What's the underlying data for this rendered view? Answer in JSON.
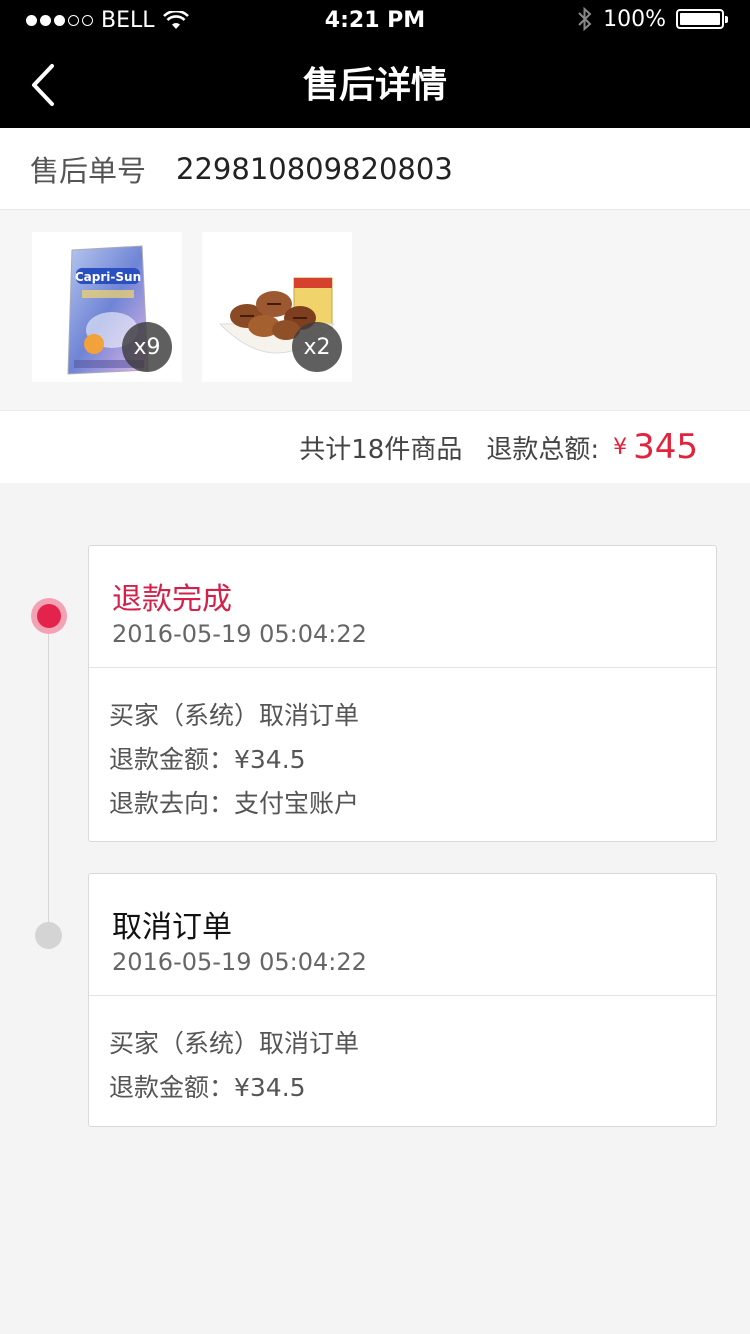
{
  "status_bar": {
    "carrier": "BELL",
    "time": "4:21 PM",
    "battery": "100%",
    "battery_level": 1.0,
    "signal_bars": 3,
    "signal_total": 5
  },
  "nav": {
    "title": "售后详情",
    "back_icon": "chevron-left-icon"
  },
  "order": {
    "label": "售后单号",
    "number": "229810809820803"
  },
  "products": [
    {
      "name_icon": "capri-sun-pouch",
      "qty": "x9"
    },
    {
      "name_icon": "pecan-nuts-bowl",
      "qty": "x2"
    }
  ],
  "summary": {
    "count": "共计18件商品",
    "refund_label": "退款总额:",
    "currency": "¥",
    "amount": "345"
  },
  "timeline": [
    {
      "title": "退款完成",
      "time": "2016-05-19 05:04:22",
      "lines": [
        "买家（系统）取消订单",
        "退款金额：¥34.5",
        "退款去向：支付宝账户"
      ]
    },
    {
      "title": "取消订单",
      "time": "2016-05-19 05:04:22",
      "lines": [
        "买家（系统）取消订单",
        "退款金额：¥34.5"
      ]
    }
  ],
  "colors": {
    "accent_red": "#e3233c",
    "status_red": "#d4204a",
    "header_bg": "#000000"
  }
}
